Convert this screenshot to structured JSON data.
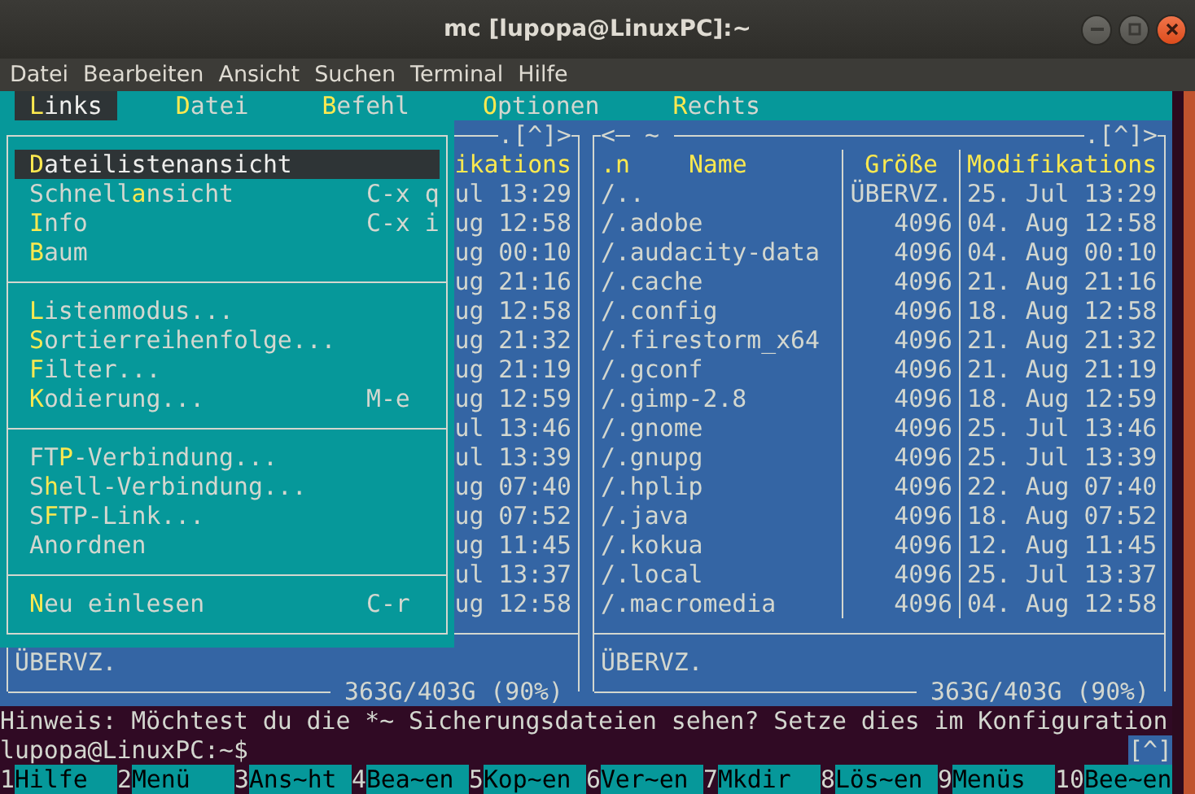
{
  "window": {
    "title": "mc [lupopa@LinuxPC]:~"
  },
  "menu_bar": [
    "Datei",
    "Bearbeiten",
    "Ansicht",
    "Suchen",
    "Terminal",
    "Hilfe"
  ],
  "mc_menu": [
    {
      "label": [
        {
          "text": "L",
          "hotkey": true
        },
        {
          "text": "inks",
          "hotkey": false
        }
      ],
      "selected": true
    },
    {
      "label": [
        {
          "text": "D",
          "hotkey": true
        },
        {
          "text": "atei",
          "hotkey": false
        }
      ],
      "selected": false
    },
    {
      "label": [
        {
          "text": "B",
          "hotkey": true
        },
        {
          "text": "efehl",
          "hotkey": false
        }
      ],
      "selected": false
    },
    {
      "label": [
        {
          "text": "O",
          "hotkey": true
        },
        {
          "text": "ptionen",
          "hotkey": false
        }
      ],
      "selected": false
    },
    {
      "label": [
        {
          "text": "R",
          "hotkey": true
        },
        {
          "text": "echts",
          "hotkey": false
        }
      ],
      "selected": false
    }
  ],
  "dropdown": {
    "groups": [
      {
        "items": [
          {
            "label": [
              {
                "text": "D",
                "hotkey": true
              },
              {
                "text": "ateilistenansicht",
                "hotkey": false
              }
            ],
            "selected": true
          },
          {
            "label": [
              {
                "text": "Schnell",
                "hotkey": false
              },
              {
                "text": "a",
                "hotkey": true
              },
              {
                "text": "nsicht",
                "hotkey": false
              }
            ],
            "shortcut": "C-x q",
            "selected": false
          },
          {
            "label": [
              {
                "text": "I",
                "hotkey": true
              },
              {
                "text": "nfo",
                "hotkey": false
              }
            ],
            "shortcut": "C-x i",
            "selected": false
          },
          {
            "label": [
              {
                "text": "B",
                "hotkey": true
              },
              {
                "text": "aum",
                "hotkey": false
              }
            ],
            "selected": false
          }
        ]
      },
      {
        "items": [
          {
            "label": [
              {
                "text": "L",
                "hotkey": true
              },
              {
                "text": "istenmodus...",
                "hotkey": false
              }
            ],
            "selected": false
          },
          {
            "label": [
              {
                "text": "S",
                "hotkey": true
              },
              {
                "text": "ortierreihenfolge...",
                "hotkey": false
              }
            ],
            "selected": false
          },
          {
            "label": [
              {
                "text": "F",
                "hotkey": true
              },
              {
                "text": "ilter...",
                "hotkey": false
              }
            ],
            "selected": false
          },
          {
            "label": [
              {
                "text": "K",
                "hotkey": true
              },
              {
                "text": "odierung...",
                "hotkey": false
              }
            ],
            "shortcut": "M-e",
            "selected": false
          }
        ]
      },
      {
        "items": [
          {
            "label": [
              {
                "text": "FT",
                "hotkey": false
              },
              {
                "text": "P",
                "hotkey": true
              },
              {
                "text": "-Verbindung...",
                "hotkey": false
              }
            ],
            "selected": false
          },
          {
            "label": [
              {
                "text": "S",
                "hotkey": false
              },
              {
                "text": "h",
                "hotkey": true
              },
              {
                "text": "ell-Verbindung...",
                "hotkey": false
              }
            ],
            "selected": false
          },
          {
            "label": [
              {
                "text": "S",
                "hotkey": false
              },
              {
                "text": "F",
                "hotkey": true
              },
              {
                "text": "TP-Link...",
                "hotkey": false
              }
            ],
            "selected": false
          },
          {
            "label": [
              {
                "text": "Anordnen",
                "hotkey": false
              }
            ],
            "selected": false
          }
        ]
      },
      {
        "items": [
          {
            "label": [
              {
                "text": "N",
                "hotkey": true
              },
              {
                "text": "eu einlesen",
                "hotkey": false
              }
            ],
            "shortcut": "C-r",
            "selected": false
          }
        ]
      }
    ]
  },
  "left_panel": {
    "controls": ".[^]>",
    "header": "ikations",
    "rows": [
      "ul 13:29",
      "ug 12:58",
      "ug 00:10",
      "ug 21:16",
      "ug 12:58",
      "ug 21:32",
      "ug 21:19",
      "ug 12:59",
      "ul 13:46",
      "ul 13:39",
      "ug 07:40",
      "ug 07:52",
      "ug 11:45",
      "ul 13:37",
      "ug 12:58"
    ],
    "status": "ÜBERVZ.",
    "disk": "363G/403G (90%)"
  },
  "right_panel": {
    "history_button": "<",
    "path": "~",
    "controls": ".[^]>",
    "sort_indicator": ".n",
    "columns": [
      "Name",
      "Größe",
      "Modifikations"
    ],
    "rows": [
      {
        "name": "/..",
        "size": "ÜBERVZ.",
        "modified": "25. Jul 13:29"
      },
      {
        "name": "/.adobe",
        "size": "4096",
        "modified": "04. Aug 12:58"
      },
      {
        "name": "/.audacity-data",
        "size": "4096",
        "modified": "04. Aug 00:10"
      },
      {
        "name": "/.cache",
        "size": "4096",
        "modified": "21. Aug 21:16"
      },
      {
        "name": "/.config",
        "size": "4096",
        "modified": "18. Aug 12:58"
      },
      {
        "name": "/.firestorm_x64",
        "size": "4096",
        "modified": "21. Aug 21:32"
      },
      {
        "name": "/.gconf",
        "size": "4096",
        "modified": "21. Aug 21:19"
      },
      {
        "name": "/.gimp-2.8",
        "size": "4096",
        "modified": "18. Aug 12:59"
      },
      {
        "name": "/.gnome",
        "size": "4096",
        "modified": "25. Jul 13:46"
      },
      {
        "name": "/.gnupg",
        "size": "4096",
        "modified": "25. Jul 13:39"
      },
      {
        "name": "/.hplip",
        "size": "4096",
        "modified": "22. Aug 07:40"
      },
      {
        "name": "/.java",
        "size": "4096",
        "modified": "18. Aug 07:52"
      },
      {
        "name": "/.kokua",
        "size": "4096",
        "modified": "12. Aug 11:45"
      },
      {
        "name": "/.local",
        "size": "4096",
        "modified": "25. Jul 13:37"
      },
      {
        "name": "/.macromedia",
        "size": "4096",
        "modified": "04. Aug 12:58"
      }
    ],
    "status": "ÜBERVZ.",
    "disk": "363G/403G (90%)"
  },
  "hint": "Hinweis: Möchtest du die *~ Sicherungsdateien sehen? Setze dies im Konfiguration",
  "prompt": "lupopa@LinuxPC:~$",
  "prompt_button": "[^]",
  "function_keys": [
    {
      "number": "1",
      "label": "Hilfe"
    },
    {
      "number": "2",
      "label": "Menü"
    },
    {
      "number": "3",
      "label": "Ans~ht"
    },
    {
      "number": "4",
      "label": "Bea~en"
    },
    {
      "number": "5",
      "label": "Kop~en"
    },
    {
      "number": "6",
      "label": "Ver~en"
    },
    {
      "number": "7",
      "label": "Mkdir"
    },
    {
      "number": "8",
      "label": "Lös~en"
    },
    {
      "number": "9",
      "label": "Menüs"
    },
    {
      "number": "10",
      "label": "Bee~en"
    }
  ]
}
